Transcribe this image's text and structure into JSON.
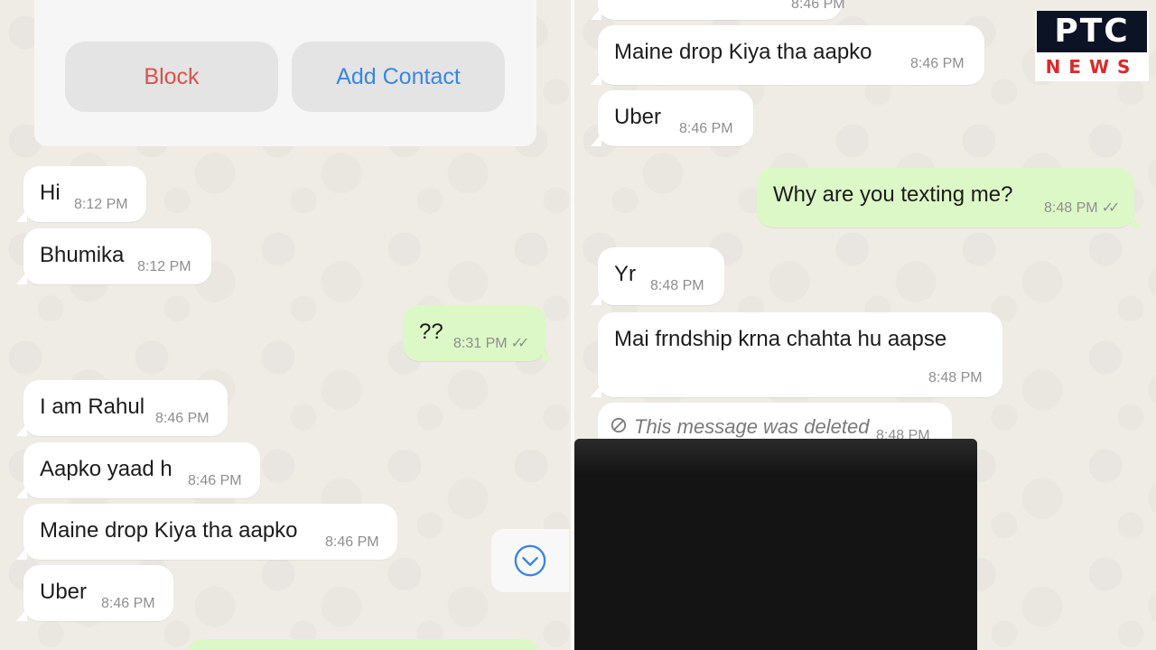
{
  "left": {
    "actions": {
      "block": "Block",
      "add_contact": "Add Contact"
    },
    "messages": [
      {
        "text": "Hi",
        "time": "8:12 PM"
      },
      {
        "text": "Bhumika",
        "time": "8:12 PM"
      },
      {
        "text": "??",
        "time": "8:31 PM"
      },
      {
        "text": "I am Rahul",
        "time": "8:46 PM"
      },
      {
        "text": "Aapko yaad h",
        "time": "8:46 PM"
      },
      {
        "text": "Maine drop Kiya tha aapko",
        "time": "8:46 PM"
      },
      {
        "text": "Uber",
        "time": "8:46 PM"
      }
    ],
    "scroll_icon": "chevron-down-circle-icon"
  },
  "right": {
    "top_partial_time": "8:46 PM",
    "messages": [
      {
        "text": "Maine drop Kiya tha aapko",
        "time": "8:46 PM"
      },
      {
        "text": "Uber",
        "time": "8:46 PM"
      },
      {
        "text": "Why are you texting me?",
        "time": "8:48 PM"
      },
      {
        "text": "Yr",
        "time": "8:48 PM"
      },
      {
        "text": "Mai frndship krna chahta hu aapse",
        "time": "8:48 PM"
      }
    ],
    "deleted": {
      "text": "This message was deleted",
      "time": "8:48 PM"
    }
  },
  "logo": {
    "top": "PTC",
    "bottom": "NEWS"
  },
  "colors": {
    "outgoing": "#dcf8c6",
    "incoming": "#ffffff",
    "block": "#d9534a",
    "add_contact": "#3b86e0",
    "logo_red": "#d92b2b"
  }
}
